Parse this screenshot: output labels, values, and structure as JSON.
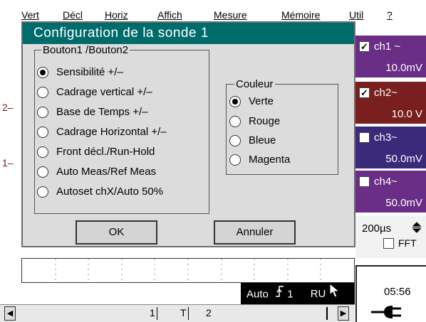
{
  "menubar": {
    "items": [
      "Vert",
      "Décl",
      "Horiz",
      "Affich",
      "Mesure",
      "Mémoire",
      "Util",
      "?"
    ]
  },
  "plot": {
    "markers": [
      "2–",
      "1–"
    ]
  },
  "dialog": {
    "title": "Configuration de la sonde 1",
    "buttons_group": {
      "legend": "Bouton1 /Bouton2",
      "options": [
        {
          "label": "Sensibilité +/–",
          "selected": true
        },
        {
          "label": "Cadrage vertical +/–",
          "selected": false
        },
        {
          "label": "Base de Temps +/–",
          "selected": false
        },
        {
          "label": "Cadrage Horizontal +/–",
          "selected": false
        },
        {
          "label": "Front décl./Run-Hold",
          "selected": false
        },
        {
          "label": "Auto Meas/Ref Meas",
          "selected": false
        },
        {
          "label": "Autoset chX/Auto 50%",
          "selected": false
        }
      ]
    },
    "color_group": {
      "legend": "Couleur",
      "options": [
        {
          "label": "Verte",
          "selected": true
        },
        {
          "label": "Rouge",
          "selected": false
        },
        {
          "label": "Bleue",
          "selected": false
        },
        {
          "label": "Magenta",
          "selected": false
        }
      ]
    },
    "ok_label": "OK",
    "cancel_label": "Annuler"
  },
  "channels": [
    {
      "name": "ch1 ~",
      "value": "10.0mV",
      "checked": true,
      "color_top": "#6b2e86",
      "color_bottom": "#6b2e86"
    },
    {
      "name": "ch2~",
      "value": "10.0 V",
      "checked": true,
      "color_top": "#7a1f1f",
      "color_bottom": "#7a1f1f"
    },
    {
      "name": "ch3~",
      "value": "50.0mV",
      "checked": false,
      "color_top": "#3b2a7a",
      "color_bottom": "#3b2a7a"
    },
    {
      "name": "ch4~",
      "value": "50.0mV",
      "checked": false,
      "color_top": "#6b2e86",
      "color_bottom": "#6b2e86"
    }
  ],
  "timebase": {
    "value": "200µs",
    "fft_label": "FFT",
    "fft_checked": false
  },
  "status": {
    "clock": "05:56",
    "trigger_mode": "Auto",
    "trigger_source": "1",
    "run_state": "RU"
  },
  "scrollbar": {
    "markers": [
      "1",
      "T",
      "2"
    ]
  },
  "icons": {
    "left_arrow": "left-arrow-icon",
    "right_arrow": "right-arrow-icon",
    "trigger_edge": "rising-edge-icon",
    "cursor": "mouse-cursor-icon",
    "power": "power-plug-icon",
    "stepper": "stepper-icon"
  },
  "colors": {
    "title_bar": "#006b6b",
    "dialog_bg": "#dcdcdc"
  }
}
